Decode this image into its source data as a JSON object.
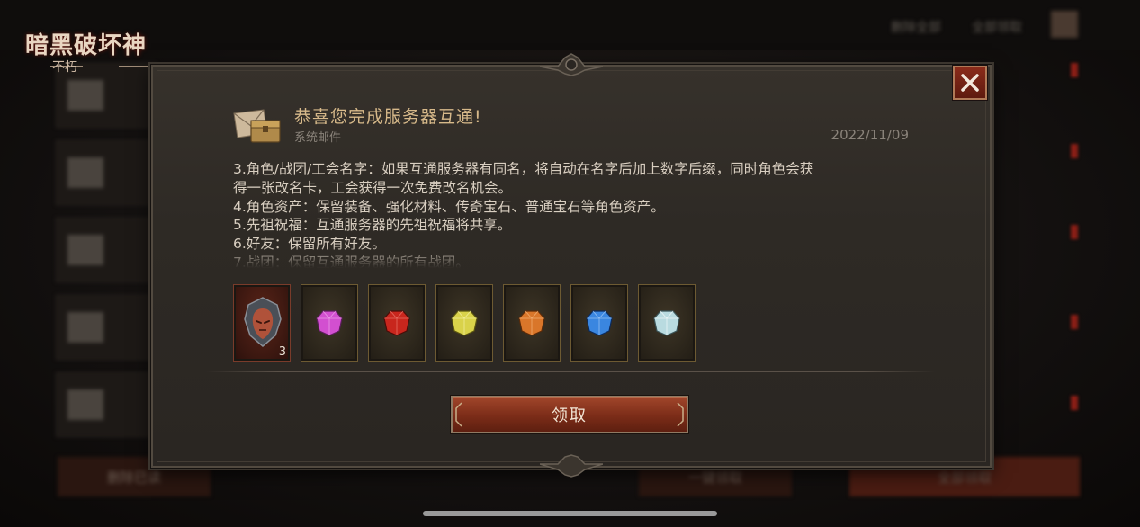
{
  "app": {
    "logo_title": "暗黑破坏神",
    "logo_subtitle": "不朽"
  },
  "background": {
    "top_items": [
      "删除全部",
      "全部领取"
    ],
    "bottom_buttons": [
      "删除已读",
      "一键领取",
      "全部领取"
    ]
  },
  "mail": {
    "title": "恭喜您完成服务器互通!",
    "sender": "系统邮件",
    "date": "2022/11/09",
    "icon": "mail-chest-icon",
    "body_lines": [
      "3.角色/战团/工会名字：如果互通服务器有同名，将自动在名字后加上数字后缀，同时角色会获",
      "得一张改名卡，工会获得一次免费改名机会。",
      "4.角色资产：保留装备、强化材料、传奇宝石、普通宝石等角色资产。",
      "5.先祖祝福：互通服务器的先祖祝福将共享。",
      "6.好友：保留所有好友。",
      "7.战团：保留互通服务器的所有战团。"
    ]
  },
  "rewards": [
    {
      "icon": "rename-helm-icon",
      "count": "3",
      "color": "#b0523a"
    },
    {
      "icon": "gem-pink-icon",
      "count": "",
      "color": "#d24fd0"
    },
    {
      "icon": "gem-red-icon",
      "count": "",
      "color": "#c8261d"
    },
    {
      "icon": "gem-yellow-icon",
      "count": "",
      "color": "#d9d24a"
    },
    {
      "icon": "gem-orange-icon",
      "count": "",
      "color": "#d9762a"
    },
    {
      "icon": "gem-blue-icon",
      "count": "",
      "color": "#3a86e0"
    },
    {
      "icon": "gem-white-icon",
      "count": "",
      "color": "#b9dbe0"
    }
  ],
  "actions": {
    "claim_label": "领取",
    "close_icon": "close-icon"
  },
  "colors": {
    "title_gold": "#d7b98a",
    "button_red": "#7b2c18",
    "panel_bg": "#2e2a25"
  }
}
